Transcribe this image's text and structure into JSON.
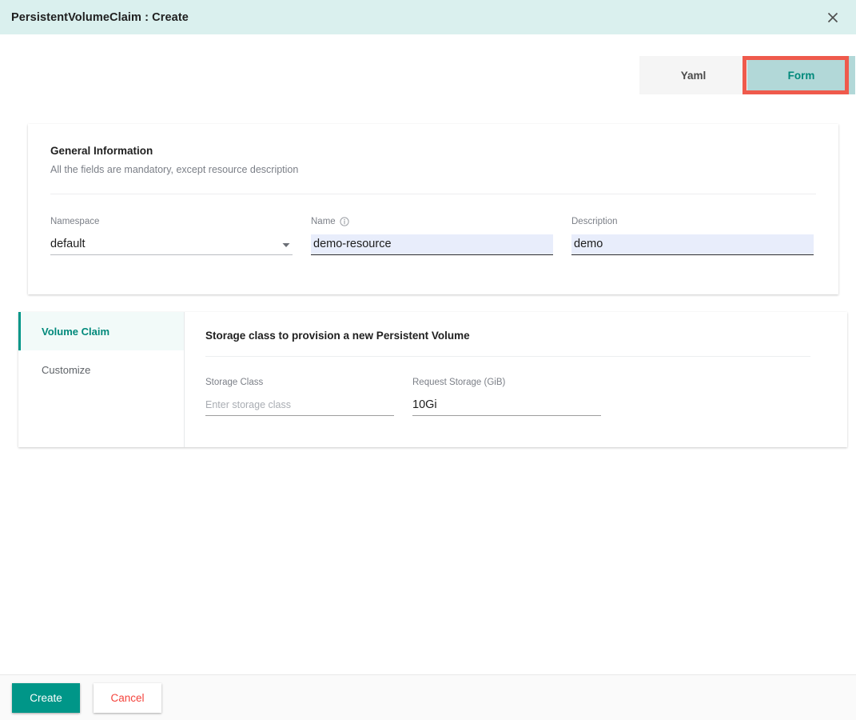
{
  "window": {
    "title": "PersistentVolumeClaim : Create",
    "close_icon": "close-icon"
  },
  "tabs": {
    "yaml_label": "Yaml",
    "form_label": "Form",
    "active": "Form",
    "highlight_color": "#ef5a4c",
    "active_bg": "#b2d8d8",
    "active_text_color": "#00897b"
  },
  "general": {
    "title": "General Information",
    "subtitle": "All the fields are mandatory, except resource description",
    "namespace": {
      "label": "Namespace",
      "value": "default",
      "icon": "chevron-down-icon"
    },
    "name": {
      "label": "Name",
      "value": "demo-resource",
      "icon": "info-icon"
    },
    "description": {
      "label": "Description",
      "value": "demo"
    }
  },
  "volume_claim": {
    "sidebar": [
      {
        "label": "Volume Claim",
        "active": true
      },
      {
        "label": "Customize",
        "active": false
      }
    ],
    "content_title": "Storage class to provision a new Persistent Volume",
    "storage_class": {
      "label": "Storage Class",
      "value": "",
      "placeholder": "Enter storage class"
    },
    "request_storage": {
      "label": "Request Storage (GiB)",
      "value": "10Gi"
    }
  },
  "footer": {
    "create_label": "Create",
    "cancel_label": "Cancel",
    "create_color": "#009688",
    "cancel_color": "#f4433c"
  }
}
